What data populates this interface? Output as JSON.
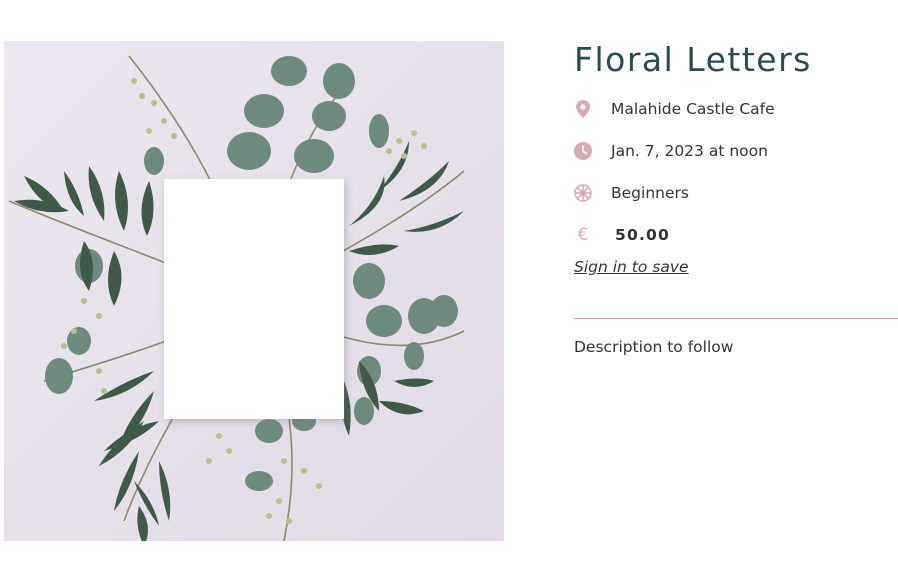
{
  "event": {
    "title": "Floral Letters",
    "location": "Malahide Castle Cafe",
    "date": "Jan. 7, 2023 at noon",
    "level": "Beginners",
    "currency_symbol": "€",
    "price": "50.00",
    "sign_in_label": "Sign in to save",
    "description": "Description to follow"
  },
  "icons": {
    "location": "map-pin-icon",
    "date": "clock-icon",
    "level": "flower-icon",
    "price": "euro-icon"
  },
  "colors": {
    "title": "#2b4a52",
    "accent": "#d9aab3",
    "text": "#333333",
    "divider": "#c9a4ab",
    "hero_background": "#e7e2ec"
  }
}
